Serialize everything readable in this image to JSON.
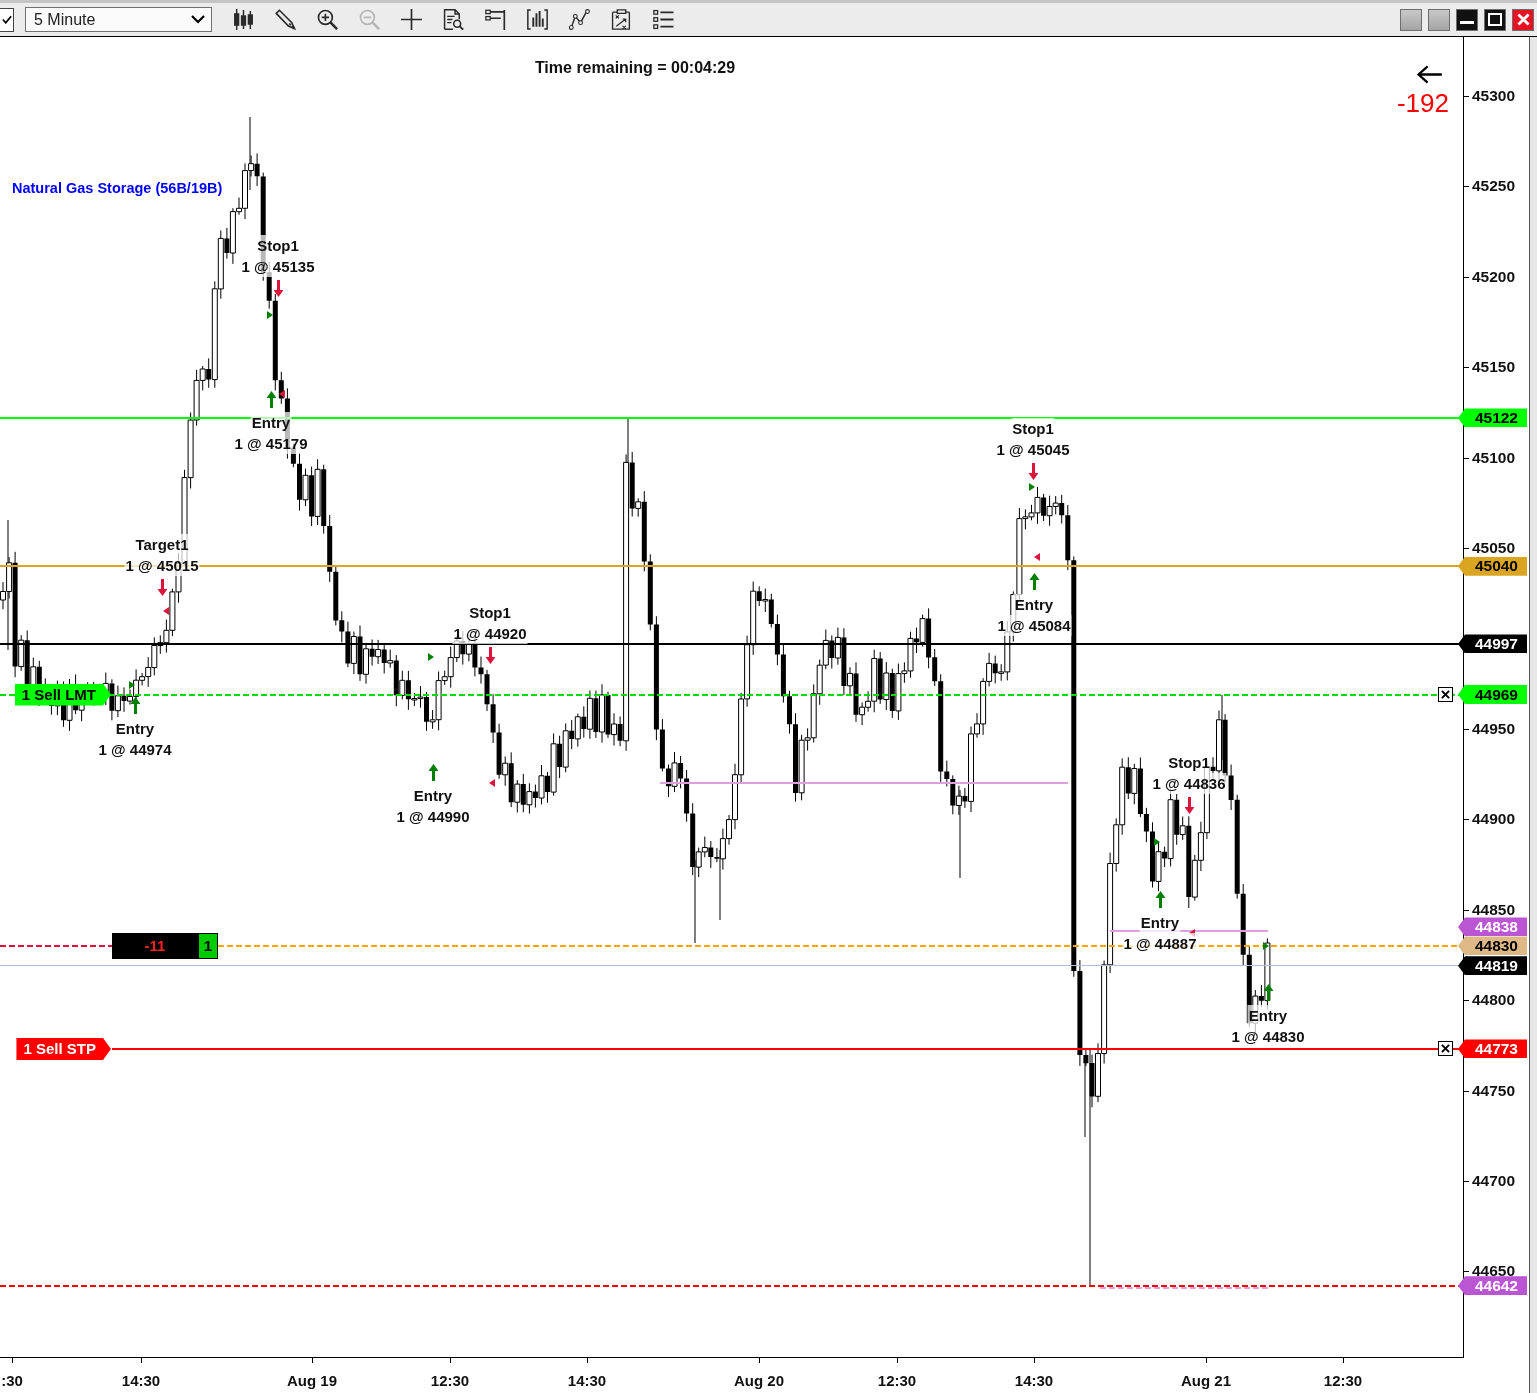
{
  "toolbar": {
    "interval": "5 Minute",
    "tools": [
      {
        "kind": "candles",
        "disabled": false
      },
      {
        "kind": "pencil",
        "disabled": false
      },
      {
        "kind": "zoom-in",
        "disabled": false
      },
      {
        "kind": "zoom-out",
        "disabled": true
      },
      {
        "kind": "crosshair",
        "disabled": false
      },
      {
        "kind": "doc-search",
        "disabled": false
      },
      {
        "kind": "panel",
        "disabled": false
      },
      {
        "kind": "bars",
        "disabled": false
      },
      {
        "kind": "line",
        "disabled": false
      },
      {
        "kind": "doc-chart",
        "disabled": false
      },
      {
        "kind": "list",
        "disabled": false
      }
    ]
  },
  "chart": {
    "timer": "Time remaining = 00:04:29",
    "pnl": "-192",
    "indicator": "Natural Gas Storage (56B/19B)",
    "price_ticks": [
      "45300",
      "45250",
      "45200",
      "45150",
      "45100",
      "45050",
      "44950",
      "44900",
      "44850",
      "44800",
      "44750",
      "44700",
      "44650"
    ],
    "time_ticks": [
      ":30",
      "14:30",
      "Aug 19",
      "12:30",
      "14:30",
      "Aug 20",
      "12:30",
      "14:30",
      "Aug 21",
      "12:30"
    ],
    "price_levels": [
      {
        "label": "45122",
        "color": "#00ff00",
        "line": {
          "color": "#00ff00",
          "dashed": false
        }
      },
      {
        "label": "45040",
        "color": "#daa520",
        "line": {
          "color": "#daa520",
          "dashed": false
        }
      },
      {
        "label": "44997",
        "color": "#000000",
        "line": {
          "color": "#000000",
          "dashed": false
        }
      },
      {
        "label": "44969",
        "color": "#00ff00",
        "line": {
          "color": "#00dd00",
          "dashed": true
        },
        "order": {
          "label": "1 Sell LMT"
        }
      },
      {
        "label": "44838",
        "color": "#ba55d3",
        "line": {
          "color": "#dda0dd",
          "dashed": false
        }
      },
      {
        "label": "44830",
        "color": "#deb887",
        "line": {
          "color": "#ffa500",
          "dashed": true
        },
        "position": {
          "pnl": "-11",
          "quantity": "1"
        }
      },
      {
        "label": "44819",
        "color": "#000000",
        "line": {
          "color": "#b0c4de",
          "dashed": false
        }
      },
      {
        "label": "44773",
        "color": "#ff0000",
        "line": {
          "color": "#ff0000",
          "dashed": false
        },
        "order": {
          "label": "1 Sell STP"
        }
      },
      {
        "label": "44642",
        "color": "#ba55d3",
        "line": {
          "color": "#ff0000",
          "dashed": true
        }
      }
    ],
    "executions": [
      {
        "kind": "stop",
        "name": "Stop1",
        "fill": "1 @ 45135"
      },
      {
        "kind": "entry",
        "name": "Entry",
        "fill": "1 @ 45179"
      },
      {
        "kind": "stop",
        "name": "Stop1",
        "fill": "1 @ 45045"
      },
      {
        "kind": "target",
        "name": "Target1",
        "fill": "1 @ 45015"
      },
      {
        "kind": "entry",
        "name": "Entry",
        "fill": "1 @ 45084"
      },
      {
        "kind": "stop",
        "name": "Stop1",
        "fill": "1 @ 44920"
      },
      {
        "kind": "entry",
        "name": "Entry",
        "fill": "1 @ 44974"
      },
      {
        "kind": "stop",
        "name": "Stop1",
        "fill": "1 @ 44836"
      },
      {
        "kind": "entry",
        "name": "Entry",
        "fill": "1 @ 44990"
      },
      {
        "kind": "entry",
        "name": "Entry",
        "fill": "1 @ 44887"
      },
      {
        "kind": "entry",
        "name": "Entry",
        "fill": "1 @ 44830"
      }
    ]
  }
}
